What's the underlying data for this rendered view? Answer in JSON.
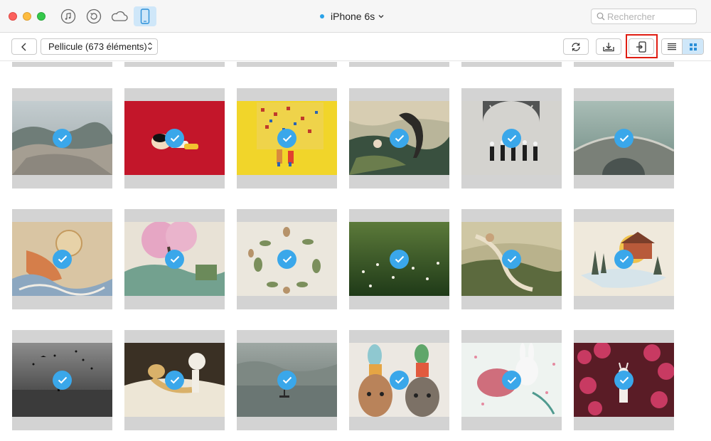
{
  "window": {
    "device_name": "iPhone 6s",
    "device_dot_color": "#2aa2e8",
    "sources": [
      "music-icon",
      "restore-icon",
      "cloud-icon",
      "device-icon"
    ]
  },
  "search": {
    "placeholder": "Rechercher"
  },
  "toolbar": {
    "album_label": "Pellicule (673 éléments)",
    "buttons": [
      "back-icon",
      "refresh-icon",
      "to-computer-icon",
      "to-device-icon",
      "list-view-icon",
      "grid-view-icon"
    ],
    "highlight_color": "#e01d12",
    "active_view": "grid"
  },
  "photos": [
    {
      "subject": "coastal rocks with people",
      "selected": true
    },
    {
      "subject": "red background figure lying",
      "selected": true
    },
    {
      "subject": "yellow pixel wall with two figures",
      "selected": true
    },
    {
      "subject": "illustrated forest with girl",
      "selected": true
    },
    {
      "subject": "people under arched window",
      "selected": true
    },
    {
      "subject": "stone arch bridge",
      "selected": true
    },
    {
      "subject": "japanese figure with waves",
      "selected": true
    },
    {
      "subject": "pink blossom tree illustration",
      "selected": true
    },
    {
      "subject": "leaf and flower wreath",
      "selected": true
    },
    {
      "subject": "green field with flowers",
      "selected": true
    },
    {
      "subject": "woman flying over landscape",
      "selected": true
    },
    {
      "subject": "snowy hut with trees",
      "selected": true
    },
    {
      "subject": "dark field with birds",
      "selected": true
    },
    {
      "subject": "cat reclining painting",
      "selected": true
    },
    {
      "subject": "misty river with boat",
      "selected": true
    },
    {
      "subject": "dog and cat with bird hats",
      "selected": true
    },
    {
      "subject": "white rabbit illustration",
      "selected": true
    },
    {
      "subject": "girl among pink flowers",
      "selected": true
    }
  ],
  "colors": {
    "selection": "#3aa7ea",
    "tile_background": "#d3d3d3",
    "active_tab": "#cfe7f9"
  }
}
